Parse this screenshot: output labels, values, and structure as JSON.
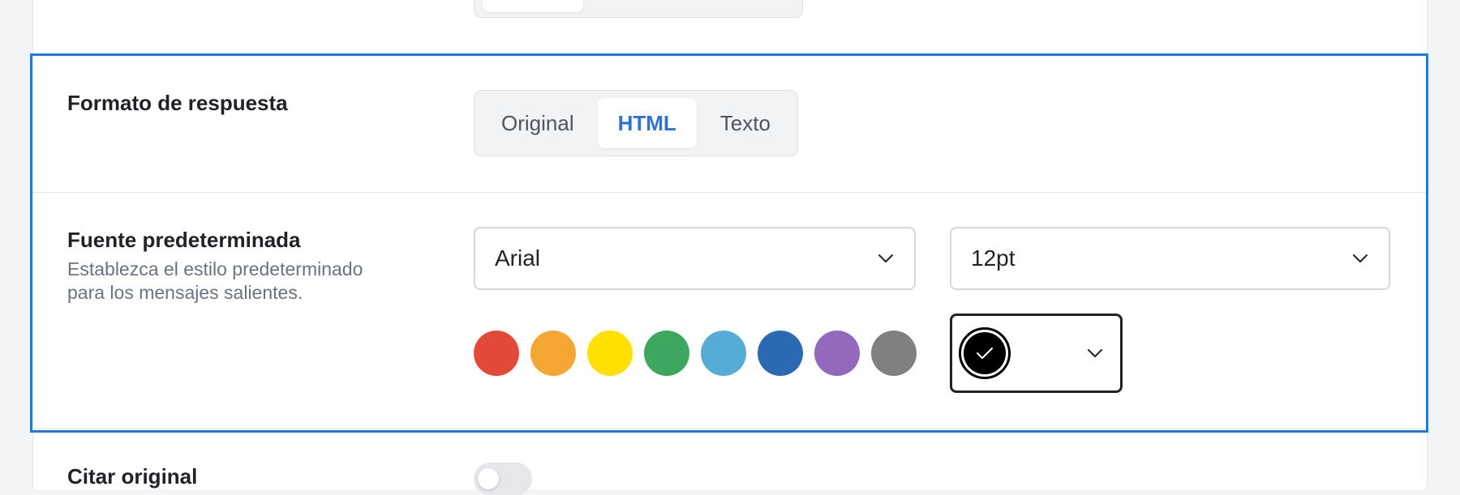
{
  "reply_format": {
    "label": "Formato de respuesta",
    "options": [
      "Original",
      "HTML",
      "Texto"
    ],
    "selected": "HTML"
  },
  "default_font": {
    "label": "Fuente predeterminada",
    "description_line1": "Establezca el estilo predeterminado",
    "description_line2": "para los mensajes salientes.",
    "font_family": "Arial",
    "font_size": "12pt",
    "swatches": [
      {
        "name": "red",
        "color": "#e24a37"
      },
      {
        "name": "orange",
        "color": "#f4a733"
      },
      {
        "name": "yellow",
        "color": "#ffe000"
      },
      {
        "name": "green",
        "color": "#3ea75f"
      },
      {
        "name": "light-blue",
        "color": "#55acd6"
      },
      {
        "name": "blue",
        "color": "#2a6ab2"
      },
      {
        "name": "purple",
        "color": "#9369bd"
      },
      {
        "name": "gray",
        "color": "#808080"
      }
    ],
    "selected_color": "#000000"
  },
  "quote_original": {
    "label": "Citar original",
    "enabled": false
  },
  "colors": {
    "accent": "#2f72d2",
    "focus_border": "#1f7ae0"
  }
}
